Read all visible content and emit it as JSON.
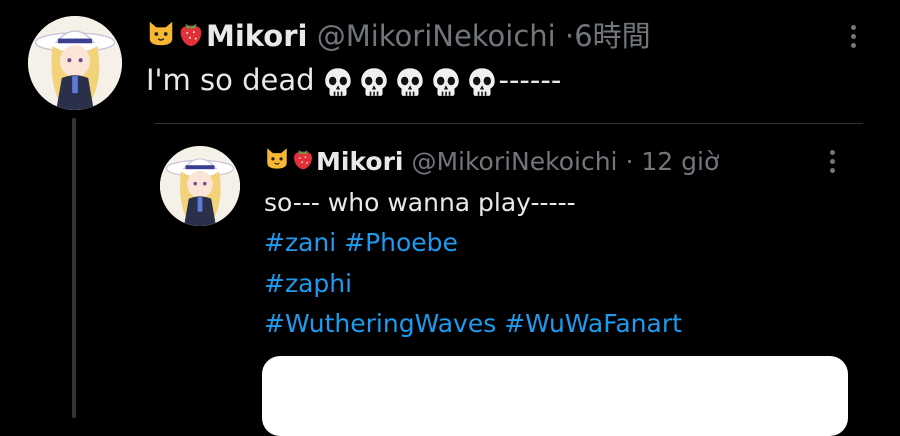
{
  "tweet": {
    "author_name": "Mikori",
    "author_handle": "@MikoriNekoichi",
    "time_separator": "·",
    "time": "6時間",
    "text": "I'm so dead",
    "text_suffix": "------",
    "skull_count": 5
  },
  "quoted": {
    "author_name": "Mikori",
    "author_handle": "@MikoriNekoichi",
    "time_separator": "·",
    "time": "12 giờ",
    "text": "so--- who wanna play-----",
    "hashtag_lines": [
      [
        "#zani",
        "#Phoebe"
      ],
      [
        "#zaphi"
      ],
      [
        "#WutheringWaves",
        "#WuWaFanart"
      ]
    ]
  },
  "icons": {
    "name_prefix": [
      "cat-face-emoji",
      "strawberry-emoji"
    ],
    "text_emoji": "skull-emoji",
    "menu": "more-options-icon"
  },
  "colors": {
    "background": "#000000",
    "text": "#e7e9ea",
    "secondary": "#71767b",
    "link": "#1d9bf0"
  }
}
